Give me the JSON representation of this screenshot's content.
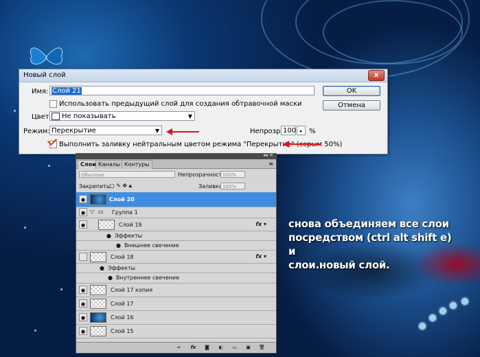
{
  "dialog": {
    "title": "Новый слой",
    "close_label": "x",
    "name_label": "Имя:",
    "name_value": "Слой 21",
    "use_previous_label": "Использовать предыдущий слой для создания обтравочной маски",
    "color_label": "Цвет:",
    "color_value": "Не показывать",
    "mode_label": "Режим:",
    "mode_value": "Перекрытие",
    "opacity_label": "Непрозр.:",
    "opacity_value": "100",
    "opacity_unit": "%",
    "fill_label": "Выполнить заливку нейтральным цветом режима \"Перекрытие\"  (серым 50%)",
    "ok_label": "OK",
    "cancel_label": "Отмена"
  },
  "panel": {
    "tabs": [
      "Слои",
      "Каналы",
      "Контуры"
    ],
    "blend_mode": "Обычные",
    "opacity_label": "Непрозрачность:",
    "opacity_value": "100%",
    "lock_label": "Закрепить:",
    "fill_label": "Заливка:",
    "fill_value": "100%",
    "layers": [
      {
        "name": "Слой 20"
      },
      {
        "name": "Группа 1"
      },
      {
        "name": "Слой 19"
      },
      {
        "name": "Эффекты"
      },
      {
        "name": "Внешнее свечение"
      },
      {
        "name": "Слой 18"
      },
      {
        "name": "Эффекты"
      },
      {
        "name": "Внутреннее свечение"
      },
      {
        "name": "Слой 17 копия"
      },
      {
        "name": "Слой 17"
      },
      {
        "name": "Слой 16"
      },
      {
        "name": "Слой 15"
      }
    ]
  },
  "caption": {
    "line1": "снова объединяем все слои",
    "line2": "посредством (ctrl alt shift e)",
    "line3": "и",
    "line4": "слои.новый слой."
  },
  "colors": {
    "arrow": "#e0111a",
    "active_layer": "#3e8de0"
  }
}
